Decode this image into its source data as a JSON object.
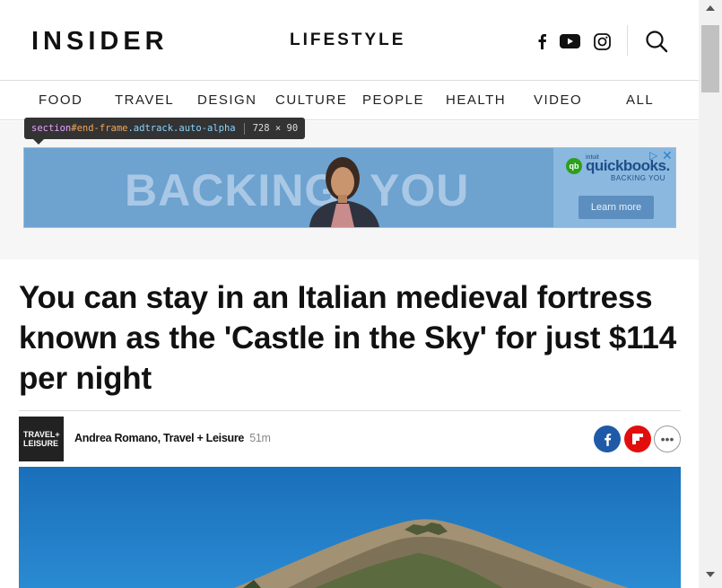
{
  "header": {
    "logo": "INSIDER",
    "section": "LIFESTYLE",
    "icons": [
      "facebook-icon",
      "youtube-icon",
      "instagram-icon",
      "search-icon"
    ]
  },
  "nav": {
    "items": [
      {
        "label": "FOOD"
      },
      {
        "label": "TRAVEL"
      },
      {
        "label": "DESIGN"
      },
      {
        "label": "CULTURE"
      },
      {
        "label": "PEOPLE"
      },
      {
        "label": "HEALTH"
      },
      {
        "label": "VIDEO"
      },
      {
        "label": "ALL"
      }
    ]
  },
  "devtools_tooltip": {
    "tag": "section",
    "id": "#end-frame",
    "classes": ".adtrack.auto-alpha",
    "dimensions": "728 × 90"
  },
  "ad": {
    "headline_left": "BACKING",
    "headline_right": "YOU",
    "brand_small": "intuit",
    "brand": "quickbooks.",
    "brand_logo_text": "qb",
    "tagline": "BACKING YOU",
    "cta": "Learn more",
    "adchoices": "▷",
    "close": "✕"
  },
  "article": {
    "headline": "You can stay in an Italian medieval fortress known as the 'Castle in the Sky' for just $114 per night",
    "source_logo_line1": "TRAVEL+",
    "source_logo_line2": "LEISURE",
    "byline": "Andrea Romano, Travel + Leisure",
    "time": "51m",
    "more": "•••"
  },
  "colors": {
    "facebook": "#1e5aa8",
    "flipboard": "#e20e0e",
    "ad_blue": "#6ea2cf",
    "sky": "#1f7ac3"
  }
}
